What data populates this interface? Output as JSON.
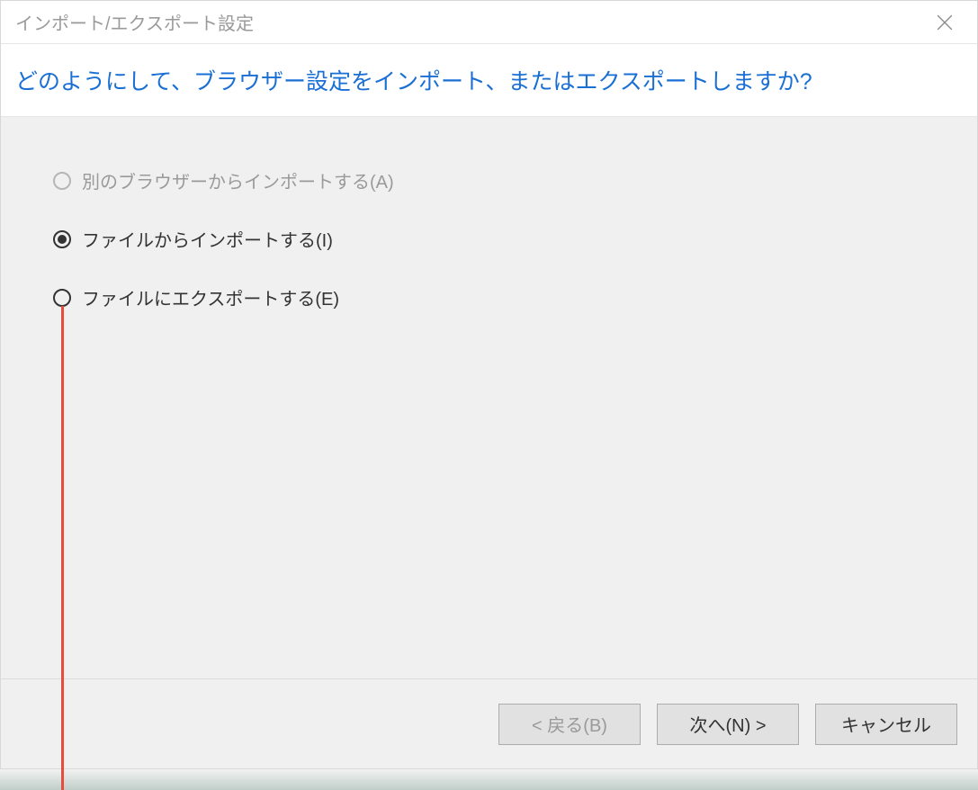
{
  "window": {
    "title": "インポート/エクスポート設定"
  },
  "heading": "どのようにして、ブラウザー設定をインポート、またはエクスポートしますか?",
  "options": {
    "import_browser": {
      "label": "別のブラウザーからインポートする(A)",
      "enabled": false,
      "selected": false
    },
    "import_file": {
      "label": "ファイルからインポートする(I)",
      "enabled": true,
      "selected": true
    },
    "export_file": {
      "label": "ファイルにエクスポートする(E)",
      "enabled": true,
      "selected": false
    }
  },
  "footer": {
    "back": "< 戻る(B)",
    "next": "次へ(N) >",
    "cancel": "キャンセル",
    "back_enabled": false
  }
}
